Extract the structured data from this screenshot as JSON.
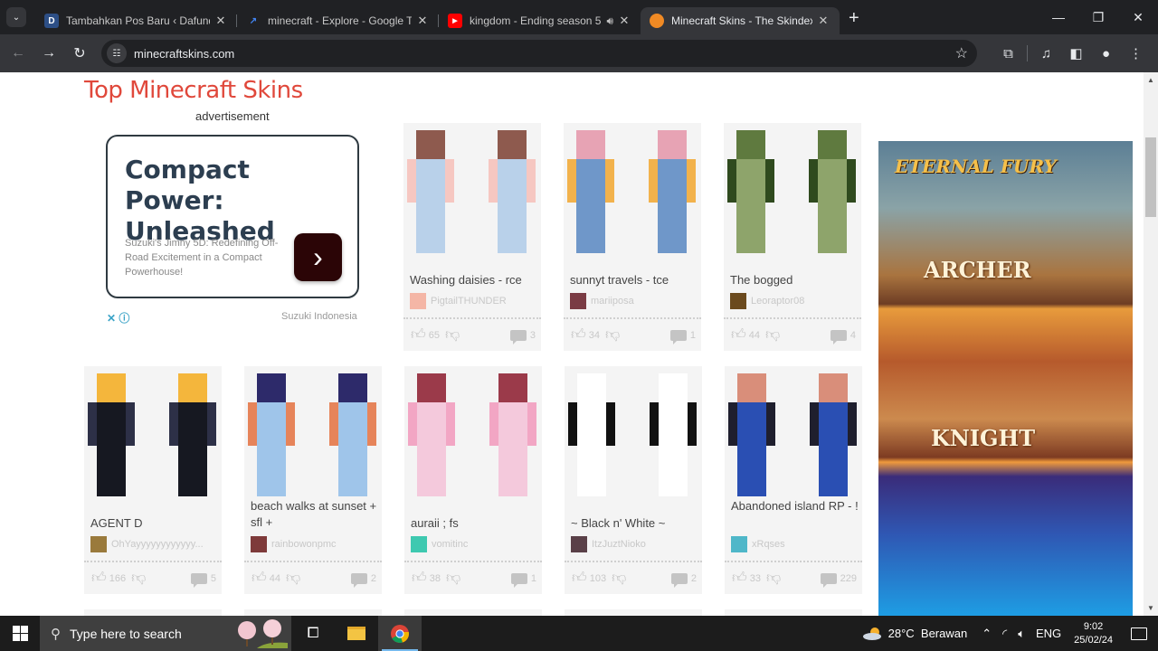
{
  "browser": {
    "tabs": [
      {
        "title": "Tambahkan Pos Baru ‹ Dafunda",
        "icon": "wordpress-d-icon",
        "active": false
      },
      {
        "title": "minecraft - Explore - Google Trends",
        "icon": "google-trends-icon",
        "active": false
      },
      {
        "title": "kingdom - Ending season 5",
        "icon": "youtube-icon",
        "active": false,
        "audio": true
      },
      {
        "title": "Minecraft Skins - The Skindex",
        "icon": "skindex-pumpkin-icon",
        "active": true
      }
    ],
    "url": "minecraftskins.com",
    "new_tab_label": "+"
  },
  "page": {
    "title": "Top Minecraft Skins",
    "ad_label": "advertisement",
    "ad": {
      "headline": "Compact Power: Unleashed",
      "body": "Suzuki's Jimny 5D: Redefining Off-Road Excitement in a Compact Powerhouse!",
      "cta": "›",
      "advertiser": "Suzuki Indonesia",
      "close": "✕ ⓘ"
    },
    "side_ad": {
      "logo": "ETERNAL FURY",
      "classes": [
        "ARCHER",
        "KNIGHT"
      ]
    },
    "skins": [
      {
        "name": "Washing daisies - rce",
        "author": "PigtailTHUNDER",
        "likes": "65",
        "comments": "3",
        "av": "#f4b6a6"
      },
      {
        "name": "sunnyt travels - tce",
        "author": "mariiposa",
        "likes": "34",
        "comments": "1",
        "av": "#7a3b44"
      },
      {
        "name": "The bogged",
        "author": "Leoraptor08",
        "likes": "44",
        "comments": "4",
        "av": "#6b4a1e"
      },
      {
        "name": "AGENT D",
        "author": "OhYayyyyyyyyyyyy...",
        "likes": "166",
        "comments": "5",
        "av": "#9a7a3c"
      },
      {
        "name": "beach walks at sunset + sfl +",
        "author": "rainbowonpmc",
        "likes": "44",
        "comments": "2",
        "av": "#7e3a3a"
      },
      {
        "name": "auraii ; fs",
        "author": "vomitinc",
        "likes": "38",
        "comments": "1",
        "av": "#3ec9b0"
      },
      {
        "name": "~ Black n' White ~",
        "author": "ItzJuztNioko",
        "likes": "103",
        "comments": "2",
        "av": "#5a4048"
      },
      {
        "name": "Abandoned island RP - !",
        "author": "xRqses",
        "likes": "33",
        "comments": "229",
        "av": "#4fb7c9"
      }
    ]
  },
  "taskbar": {
    "search_placeholder": "Type here to search",
    "weather": "28°C  Berawan",
    "lang": "ENG",
    "time": "9:02",
    "date": "25/02/24"
  },
  "colors": {
    "title_red": "#e0483b",
    "card_bg": "#f4f4f4"
  }
}
